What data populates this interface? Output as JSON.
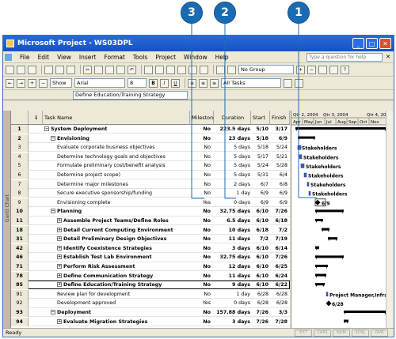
{
  "callouts": [
    "3",
    "2",
    "1"
  ],
  "window": {
    "title": "Microsoft Project - WS03DPL"
  },
  "menu": [
    "File",
    "Edit",
    "View",
    "Insert",
    "Format",
    "Tools",
    "Project",
    "Window",
    "Help"
  ],
  "help_placeholder": "Type a question for help",
  "toolbar": {
    "group": "No Group",
    "show_label": "Show",
    "font": "Arial",
    "font_size": "8",
    "filter": "All Tasks"
  },
  "entry_bar": {
    "value": "Define Education/Training Strategy"
  },
  "columns": {
    "task_name": "Task Name",
    "milestone": "Milestone",
    "duration": "Duration",
    "start": "Start",
    "finish": "Finish"
  },
  "timescale": {
    "quarters": [
      "Qtr 2, 2004",
      "Qtr 3, 2004",
      "Qtr 4, 20"
    ],
    "months": [
      "Apr",
      "May",
      "Jun",
      "Jul",
      "Aug",
      "Sep",
      "Oct",
      "Nov"
    ]
  },
  "sidebar_label": "Gantt Chart",
  "rows": [
    {
      "id": "1",
      "name": "System Deployment",
      "ms": "No",
      "dur": "223.5 days",
      "start": "5/10",
      "finish": "3/17",
      "bold": true,
      "indent": 0,
      "box": "minus"
    },
    {
      "id": "2",
      "name": "Envisioning",
      "ms": "No",
      "dur": "23 days",
      "start": "5/18",
      "finish": "6/9",
      "bold": true,
      "indent": 1,
      "box": "minus"
    },
    {
      "id": "3",
      "name": "Evaluate corporate business objectives",
      "ms": "No",
      "dur": "5 days",
      "start": "5/18",
      "finish": "5/24",
      "bold": false,
      "indent": 2,
      "box": ""
    },
    {
      "id": "4",
      "name": "Determine technology goals and objectives",
      "ms": "No",
      "dur": "5 days",
      "start": "5/17",
      "finish": "5/21",
      "bold": false,
      "indent": 2,
      "box": ""
    },
    {
      "id": "5",
      "name": "Formulate preliminary cost/benefit analysis",
      "ms": "No",
      "dur": "5 days",
      "start": "5/24",
      "finish": "5/28",
      "bold": false,
      "indent": 2,
      "box": ""
    },
    {
      "id": "6",
      "name": "Determine project scope)",
      "ms": "No",
      "dur": "5 days",
      "start": "5/31",
      "finish": "6/4",
      "bold": false,
      "indent": 2,
      "box": ""
    },
    {
      "id": "7",
      "name": "Determine major milestones",
      "ms": "No",
      "dur": "2 days",
      "start": "6/7",
      "finish": "6/8",
      "bold": false,
      "indent": 2,
      "box": ""
    },
    {
      "id": "8",
      "name": "Secure executive sponsorship/funding",
      "ms": "No",
      "dur": "1 day",
      "start": "6/9",
      "finish": "6/9",
      "bold": false,
      "indent": 2,
      "box": ""
    },
    {
      "id": "9",
      "name": "Envisioning complete",
      "ms": "Yes",
      "dur": "0 days",
      "start": "6/9",
      "finish": "6/9",
      "bold": false,
      "indent": 2,
      "box": ""
    },
    {
      "id": "10",
      "name": "Planning",
      "ms": "No",
      "dur": "32.75 days",
      "start": "6/10",
      "finish": "7/26",
      "bold": true,
      "indent": 1,
      "box": "minus"
    },
    {
      "id": "11",
      "name": "Assemble Project Teams/Define Roles",
      "ms": "No",
      "dur": "6.5 days",
      "start": "6/10",
      "finish": "6/18",
      "bold": true,
      "indent": 2,
      "box": "plus"
    },
    {
      "id": "18",
      "name": "Detail Current Computing Environment",
      "ms": "No",
      "dur": "10 days",
      "start": "6/18",
      "finish": "7/2",
      "bold": true,
      "indent": 2,
      "box": "plus"
    },
    {
      "id": "31",
      "name": "Detail Preliminary Design Objectives",
      "ms": "No",
      "dur": "11 days",
      "start": "7/2",
      "finish": "7/19",
      "bold": true,
      "indent": 2,
      "box": "plus"
    },
    {
      "id": "42",
      "name": "Identify Coexistence Strategies",
      "ms": "No",
      "dur": "3 days",
      "start": "6/10",
      "finish": "6/14",
      "bold": true,
      "indent": 2,
      "box": "plus"
    },
    {
      "id": "46",
      "name": "Establish Test Lab Environment",
      "ms": "No",
      "dur": "32.75 days",
      "start": "6/10",
      "finish": "7/26",
      "bold": true,
      "indent": 2,
      "box": "plus"
    },
    {
      "id": "71",
      "name": "Perform Risk Assessment",
      "ms": "No",
      "dur": "12 days",
      "start": "6/10",
      "finish": "6/25",
      "bold": true,
      "indent": 2,
      "box": "plus"
    },
    {
      "id": "78",
      "name": "Define Communication Strategy",
      "ms": "No",
      "dur": "11 days",
      "start": "6/10",
      "finish": "6/24",
      "bold": true,
      "indent": 2,
      "box": "plus"
    },
    {
      "id": "85",
      "name": "Define Education/Training Strategy",
      "ms": "No",
      "dur": "9 days",
      "start": "6/10",
      "finish": "6/22",
      "bold": true,
      "indent": 2,
      "box": "plus",
      "selected": true
    },
    {
      "id": "91",
      "name": "Review plan for development",
      "ms": "No",
      "dur": "1 day",
      "start": "6/28",
      "finish": "6/28",
      "bold": false,
      "indent": 2,
      "box": ""
    },
    {
      "id": "92",
      "name": "Development approved",
      "ms": "Yes",
      "dur": "0 days",
      "start": "6/28",
      "finish": "6/28",
      "bold": false,
      "indent": 2,
      "box": ""
    },
    {
      "id": "93",
      "name": "Deployment",
      "ms": "No",
      "dur": "157.88 days",
      "start": "7/26",
      "finish": "3/3",
      "bold": true,
      "indent": 1,
      "box": "minus"
    },
    {
      "id": "94",
      "name": "Evaluate Migration Strategies",
      "ms": "No",
      "dur": "3 days",
      "start": "7/26",
      "finish": "7/28",
      "bold": true,
      "indent": 2,
      "box": "plus"
    }
  ],
  "gantt_labels": [
    "Stakeholders",
    "Stakeholders",
    "Stakeholders",
    "Stakeholders",
    "Stakeholders",
    "Stakeholders",
    "6/9",
    "Project Manager,Infra",
    "6/28"
  ],
  "status": {
    "text": "Ready",
    "indicators": [
      "EXT",
      "CAPS",
      "NUM",
      "SCRL",
      "OVR"
    ]
  }
}
